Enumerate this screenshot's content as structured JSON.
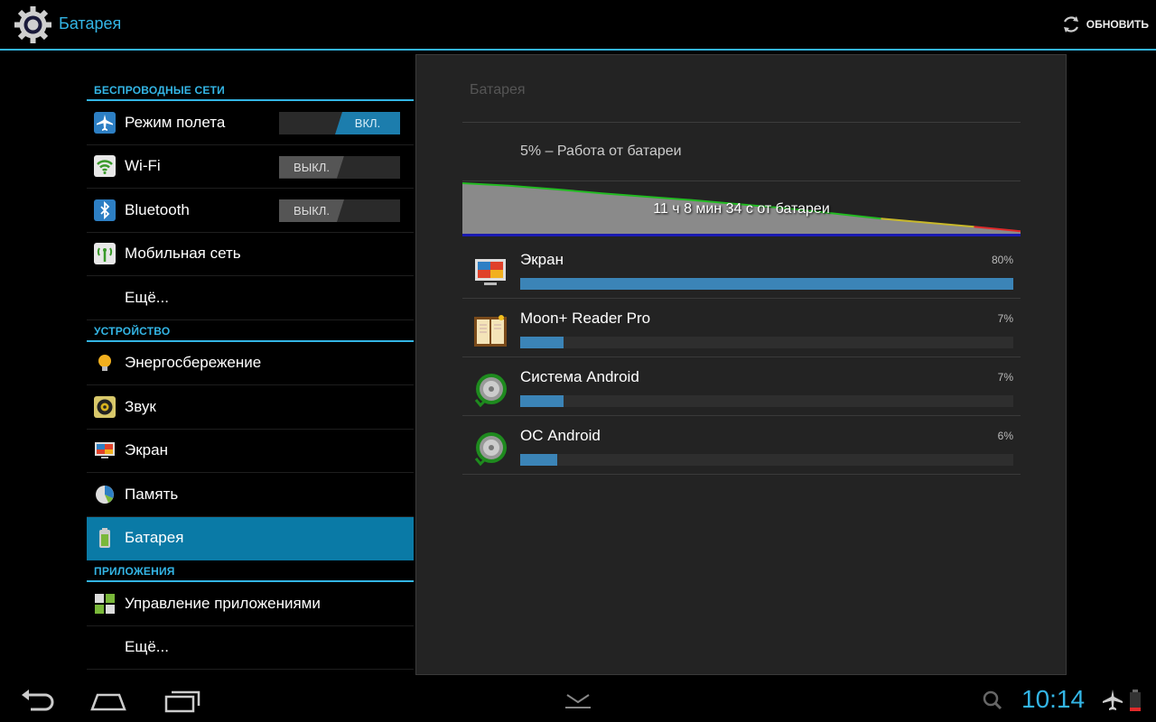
{
  "header": {
    "title": "Батарея",
    "refresh_label": "ОБНОВИТЬ",
    "app_icon": "settings-gear-icon",
    "accent": "#33b5e5"
  },
  "sidebar": {
    "sections": [
      {
        "header": "БЕСПРОВОДНЫЕ СЕТИ",
        "items": [
          {
            "label": "Режим полета",
            "icon": "airplane-icon",
            "toggle": "ВКЛ.",
            "toggle_state": "on"
          },
          {
            "label": "Wi-Fi",
            "icon": "wifi-icon",
            "toggle": "ВЫКЛ.",
            "toggle_state": "off"
          },
          {
            "label": "Bluetooth",
            "icon": "bluetooth-icon",
            "toggle": "ВЫКЛ.",
            "toggle_state": "off"
          },
          {
            "label": "Мобильная сеть",
            "icon": "mobile-network-icon"
          },
          {
            "label": "Ещё..."
          }
        ]
      },
      {
        "header": "УСТРОЙСТВО",
        "items": [
          {
            "label": "Энергосбережение",
            "icon": "lightbulb-icon"
          },
          {
            "label": "Звук",
            "icon": "speaker-icon"
          },
          {
            "label": "Экран",
            "icon": "display-icon"
          },
          {
            "label": "Память",
            "icon": "storage-pie-icon"
          },
          {
            "label": "Батарея",
            "icon": "battery-icon",
            "selected": true
          }
        ]
      },
      {
        "header": "ПРИЛОЖЕНИЯ",
        "items": [
          {
            "label": "Управление приложениями",
            "icon": "apps-grid-icon"
          },
          {
            "label": "Ещё..."
          }
        ]
      }
    ]
  },
  "battery": {
    "panel_title": "Батарея",
    "status": "5% – Работа от батареи",
    "graph_label": "11 ч 8 мин 34 с от батареи",
    "charge_curve_percent": [
      100,
      95,
      88,
      80,
      73,
      66,
      58,
      50,
      40,
      30,
      22,
      14,
      5
    ],
    "usage": [
      {
        "name": "Экран",
        "percent": 80,
        "percent_label": "80%",
        "icon": "display-icon"
      },
      {
        "name": "Moon+ Reader Pro",
        "percent": 7,
        "percent_label": "7%",
        "icon": "book-icon"
      },
      {
        "name": "Система Android",
        "percent": 7,
        "percent_label": "7%",
        "icon": "android-system-icon"
      },
      {
        "name": "ОС Android",
        "percent": 6,
        "percent_label": "6%",
        "icon": "android-os-icon"
      }
    ]
  },
  "status_bar": {
    "clock": "10:14"
  }
}
